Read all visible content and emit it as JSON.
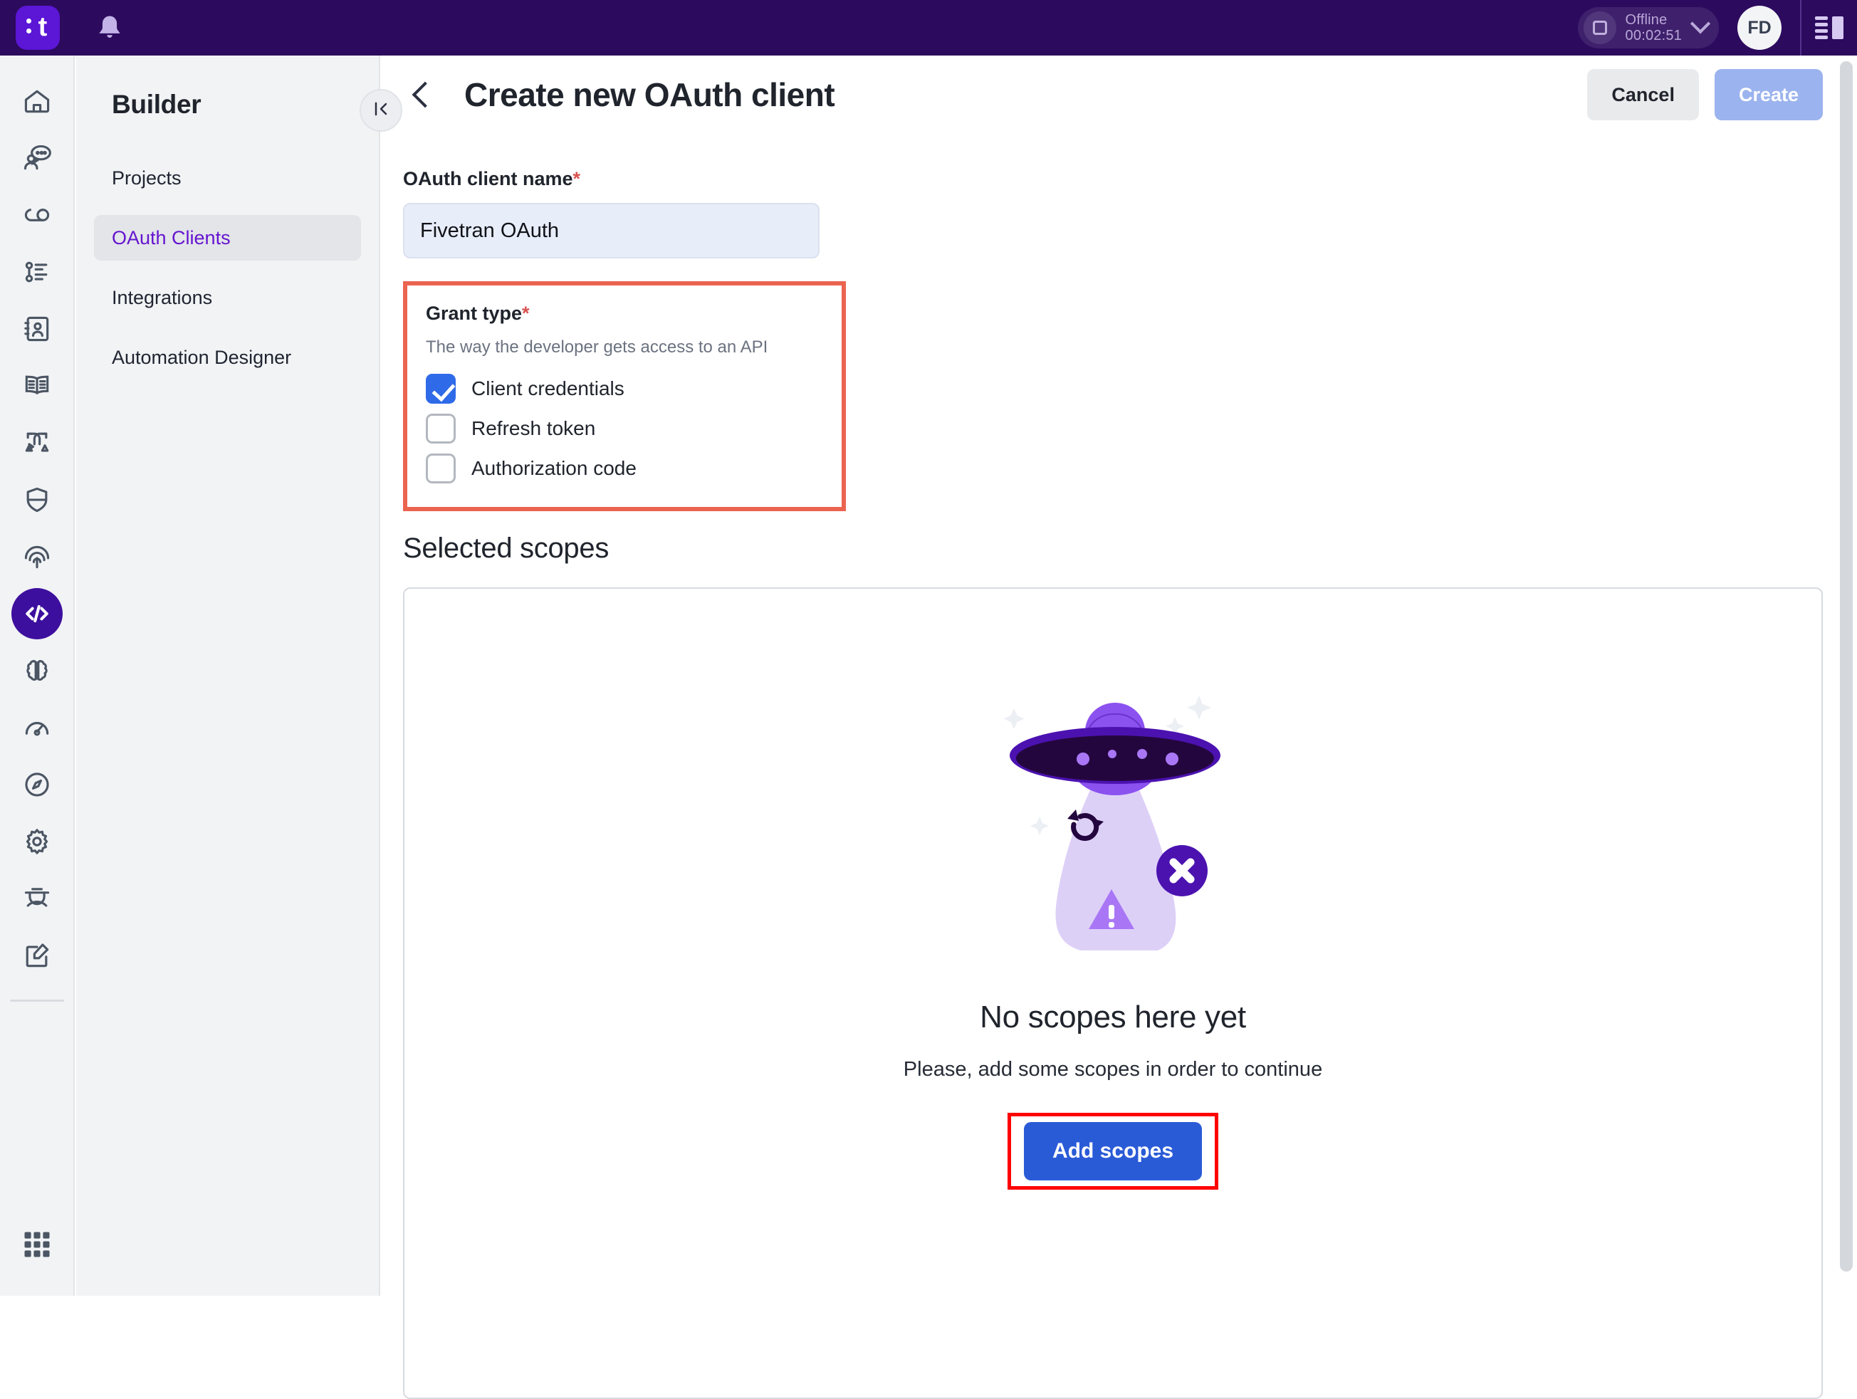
{
  "topbar": {
    "logo_letter": "t",
    "status": {
      "label": "Offline",
      "timer": "00:02:51"
    },
    "avatar_initials": "FD"
  },
  "rail": {
    "items": [
      {
        "name": "home-icon"
      },
      {
        "name": "chat-user-icon"
      },
      {
        "name": "link-chain-icon"
      },
      {
        "name": "task-list-icon"
      },
      {
        "name": "contact-book-icon"
      },
      {
        "name": "open-book-icon"
      },
      {
        "name": "workflow-split-icon"
      },
      {
        "name": "shield-icon"
      },
      {
        "name": "fingerprint-icon"
      },
      {
        "name": "code-brackets-icon",
        "active": true
      },
      {
        "name": "brain-icon"
      },
      {
        "name": "gauge-icon"
      },
      {
        "name": "compass-icon"
      },
      {
        "name": "gear-icon"
      },
      {
        "name": "graduation-cap-icon"
      },
      {
        "name": "edit-note-icon"
      }
    ],
    "apps_grid": "apps-grid-icon"
  },
  "sidebar": {
    "title": "Builder",
    "items": [
      {
        "label": "Projects",
        "active": false
      },
      {
        "label": "OAuth Clients",
        "active": true
      },
      {
        "label": "Integrations",
        "active": false
      },
      {
        "label": "Automation Designer",
        "active": false
      }
    ]
  },
  "header": {
    "title": "Create new OAuth client",
    "cancel_label": "Cancel",
    "create_label": "Create"
  },
  "form": {
    "client_name": {
      "label": "OAuth client name",
      "required_mark": "*",
      "value": "Fivetran OAuth",
      "placeholder": "OAuth client name"
    },
    "grant_type": {
      "label": "Grant type",
      "required_mark": "*",
      "description": "The way the developer gets access to an API",
      "options": [
        {
          "label": "Client credentials",
          "checked": true
        },
        {
          "label": "Refresh token",
          "checked": false
        },
        {
          "label": "Authorization code",
          "checked": false
        }
      ]
    }
  },
  "scopes": {
    "section_title": "Selected scopes",
    "empty_title": "No scopes here yet",
    "empty_subtitle": "Please, add some scopes in order to continue",
    "add_button_label": "Add scopes",
    "illustration": "ufo-abduction-illustration"
  },
  "colors": {
    "brand_purple": "#2c0a5e",
    "logo_violet": "#5b16d6",
    "accent_link": "#6615cf",
    "primary_blue": "#2a5bd7",
    "checkbox_blue": "#2f6ae8",
    "highlight_red": "#ff0000",
    "highlight_orange": "#eb6450",
    "required_red": "#d9534f"
  }
}
